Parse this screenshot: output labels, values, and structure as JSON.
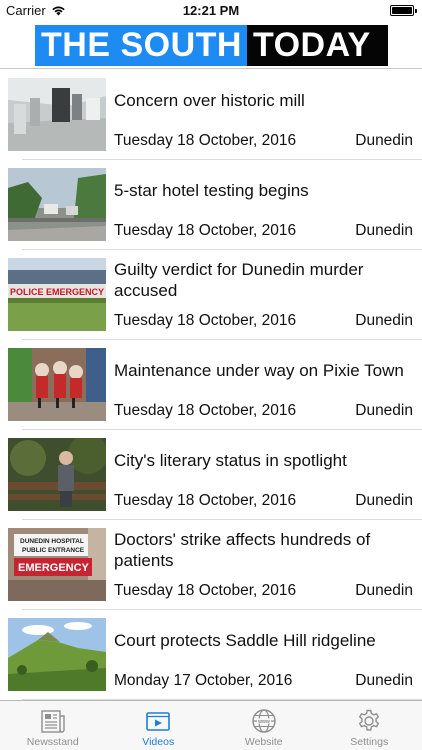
{
  "status_bar": {
    "carrier": "Carrier",
    "time": "12:21 PM"
  },
  "header": {
    "logo_part1": "THE SOUTH",
    "logo_part2": "TODAY",
    "logo_colors": {
      "primary": "#1e8bf2",
      "secondary": "#050505"
    }
  },
  "articles": [
    {
      "title": "Concern over historic mill",
      "date": "Tuesday 18 October, 2016",
      "location": "Dunedin"
    },
    {
      "title": "5-star hotel testing begins",
      "date": "Tuesday 18 October, 2016",
      "location": "Dunedin"
    },
    {
      "title": "Guilty verdict for Dunedin murder accused",
      "date": "Tuesday 18 October, 2016",
      "location": "Dunedin"
    },
    {
      "title": "Maintenance under way on Pixie Town",
      "date": "Tuesday 18 October, 2016",
      "location": "Dunedin"
    },
    {
      "title": "City's literary status in spotlight",
      "date": "Tuesday 18 October, 2016",
      "location": "Dunedin"
    },
    {
      "title": "Doctors' strike affects hundreds of patients",
      "date": "Tuesday 18 October, 2016",
      "location": "Dunedin"
    },
    {
      "title": "Court protects Saddle Hill ridgeline",
      "date": "Monday 17 October, 2016",
      "location": "Dunedin"
    }
  ],
  "thumbnail_text": {
    "police_sign": "POLICE EMERGENCY",
    "hospital_sign_1": "DUNEDIN HOSPITAL",
    "hospital_sign_2": "PUBLIC ENTRANCE",
    "emergency_sign": "EMERGENCY"
  },
  "tabbar": {
    "active_color": "#1e7ed6",
    "items": [
      {
        "label": "Newsstand",
        "icon": "newspaper-icon"
      },
      {
        "label": "Videos",
        "icon": "video-icon",
        "active": true
      },
      {
        "label": "Website",
        "icon": "globe-icon"
      },
      {
        "label": "Settings",
        "icon": "gear-icon"
      }
    ]
  }
}
